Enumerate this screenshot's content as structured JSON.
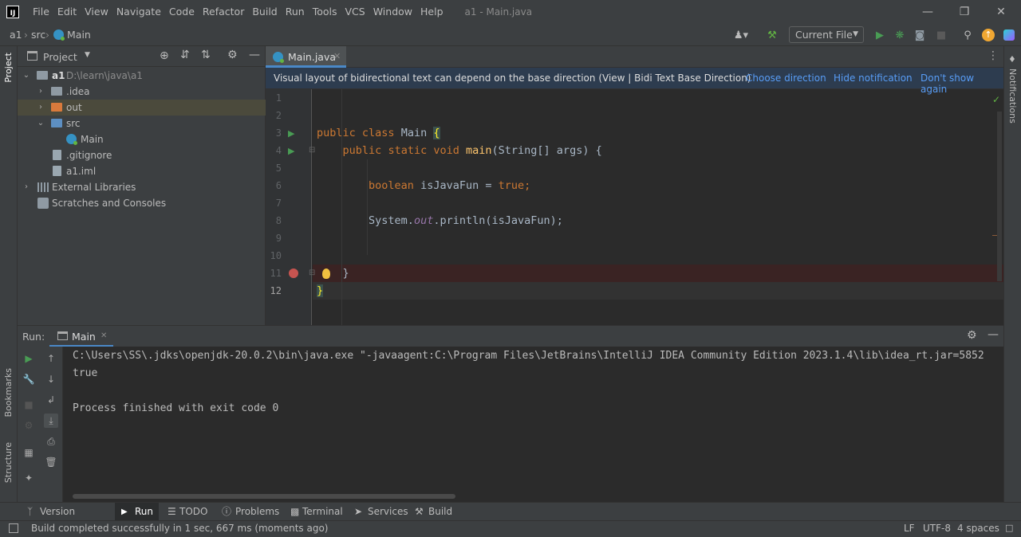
{
  "menu": {
    "items": [
      "File",
      "Edit",
      "View",
      "Navigate",
      "Code",
      "Refactor",
      "Build",
      "Run",
      "Tools",
      "VCS",
      "Window",
      "Help"
    ],
    "window_title": "a1 - Main.java"
  },
  "breadcrumb": {
    "project": "a1",
    "folder": "src",
    "file": "Main"
  },
  "toolbar": {
    "run_config": "Current File"
  },
  "project_panel": {
    "title": "Project",
    "root": {
      "name": "a1",
      "path": "D:\\learn\\java\\a1"
    },
    "tree": {
      "idea": ".idea",
      "out": "out",
      "src": "src",
      "main": "Main",
      "gitignore": ".gitignore",
      "iml": "a1.iml",
      "external_libraries": "External Libraries",
      "scratches": "Scratches and Consoles"
    }
  },
  "side_labels": {
    "project": "Project",
    "bookmarks": "Bookmarks",
    "structure": "Structure",
    "notifications": "Notifications"
  },
  "editor": {
    "tab_label": "Main.java",
    "notification": {
      "text": "Visual layout of bidirectional text can depend on the base direction (View | Bidi Text Base Direction)",
      "choose": "Choose direction",
      "hide": "Hide notification",
      "dont_show": "Don't show again"
    },
    "line_numbers": [
      "1",
      "2",
      "3",
      "4",
      "5",
      "6",
      "7",
      "8",
      "9",
      "10",
      "11",
      "12"
    ],
    "code": {
      "l3_kw1": "public",
      "l3_kw2": "class",
      "l3_name": "Main",
      "l3_brace": "{",
      "l4_kw1": "public",
      "l4_kw2": "static",
      "l4_kw3": "void",
      "l4_fn": "main",
      "l4_rest": "(String[] args) {",
      "l6_type": "boolean",
      "l6_mid": "isJavaFun =",
      "l6_val": "true",
      "l6_end": ";",
      "l8_a": "System.",
      "l8_field": "out",
      "l8_b": ".println(isJavaFun);",
      "l11": "}",
      "l12": "}"
    }
  },
  "run_panel": {
    "label": "Run:",
    "tab": "Main",
    "console": [
      "C:\\Users\\SS\\.jdks\\openjdk-20.0.2\\bin\\java.exe \"-javaagent:C:\\Program Files\\JetBrains\\IntelliJ IDEA Community Edition 2023.1.4\\lib\\idea_rt.jar=5852",
      "true",
      "",
      "Process finished with exit code 0"
    ]
  },
  "bottom_tabs": {
    "version_control": "Version Control",
    "run": "Run",
    "todo": "TODO",
    "problems": "Problems",
    "terminal": "Terminal",
    "services": "Services",
    "build": "Build"
  },
  "status_bar": {
    "message": "Build completed successfully in 1 sec, 667 ms (moments ago)",
    "line_separator": "LF",
    "encoding": "UTF-8",
    "indent": "4 spaces"
  },
  "colors": {
    "accent": "#4a88c7",
    "keyword": "#cc7832",
    "function": "#ffc66d",
    "breakpoint": "#c75450",
    "run_green": "#499c54"
  }
}
